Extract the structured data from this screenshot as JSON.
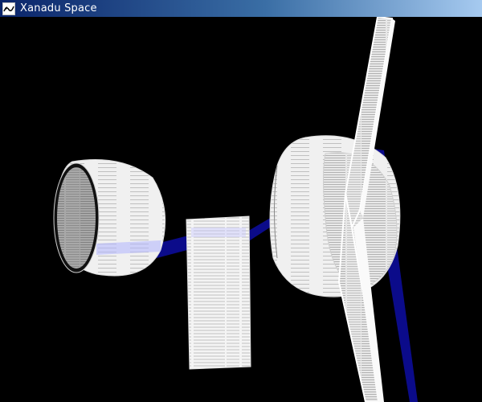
{
  "window": {
    "title": "Xanadu Space",
    "icon": "xanadu-logo-icon"
  },
  "scene": {
    "background_color": "#000000",
    "link_color": "#0a0a80",
    "page_color": "#ffffff",
    "highlight_color": "#9aa0ff",
    "objects": [
      {
        "name": "left-cylinder-document",
        "type": "cylinder"
      },
      {
        "name": "center-flat-document",
        "type": "flat-page"
      },
      {
        "name": "right-cylinder-document",
        "type": "cylinder"
      },
      {
        "name": "right-tilted-page-document",
        "type": "angled-page"
      }
    ]
  }
}
